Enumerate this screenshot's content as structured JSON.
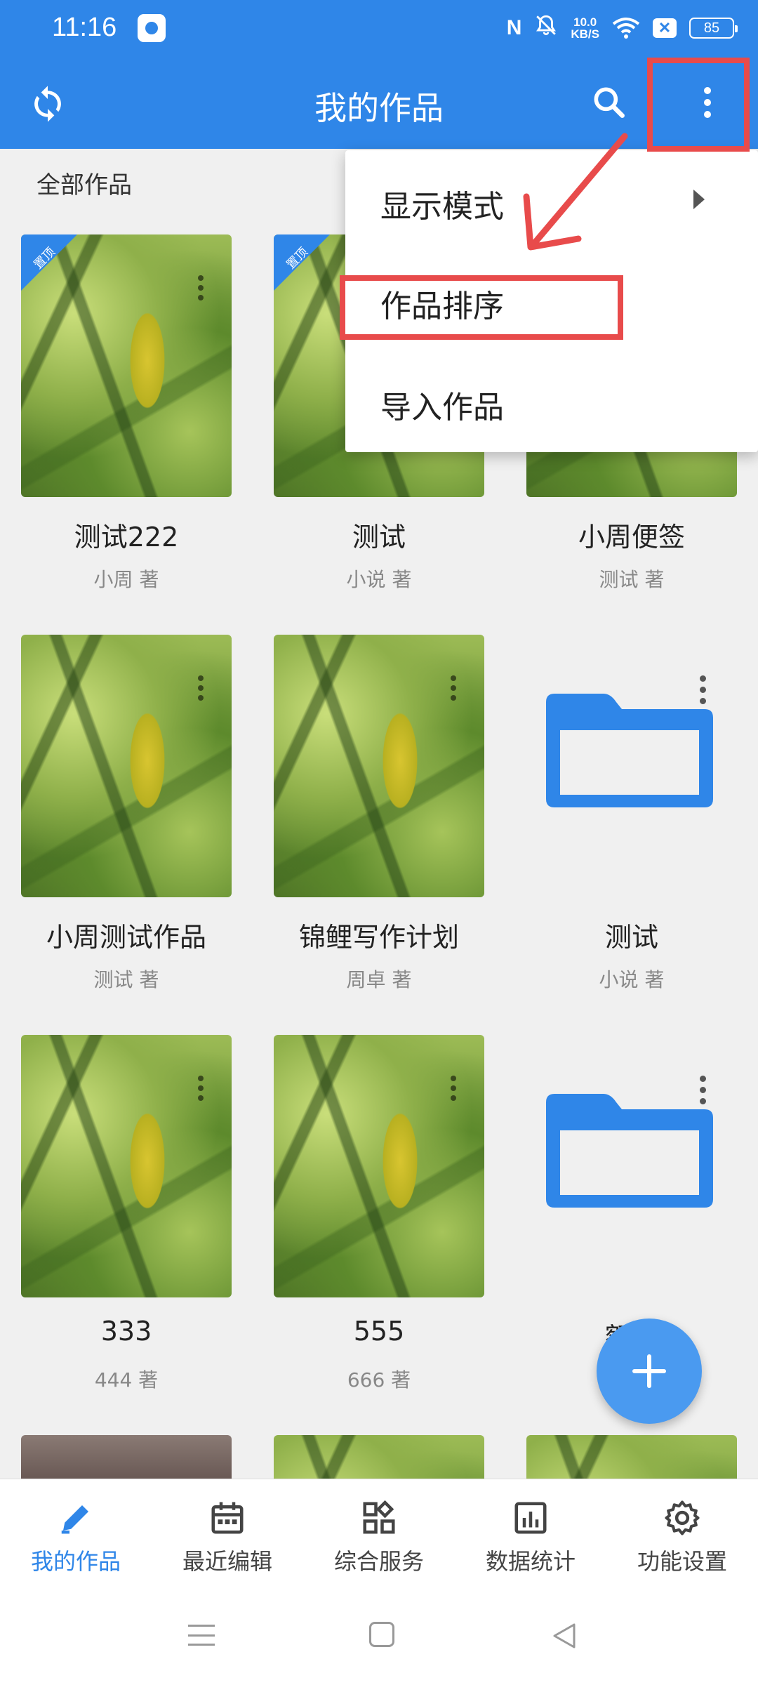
{
  "status_bar": {
    "time": "11:16",
    "nfc": "N",
    "speed_value": "10.0",
    "speed_unit": "KB/S",
    "battery": "85"
  },
  "app_bar": {
    "title": "我的作品"
  },
  "section_label": "全部作品",
  "pin_label": "置顶",
  "works": [
    {
      "title": "测试222",
      "author": "小周 著",
      "type": "cover",
      "pinned": true
    },
    {
      "title": "测试",
      "author": "小说 著",
      "type": "cover",
      "pinned": true
    },
    {
      "title": "小周便签",
      "author": "测试 著",
      "type": "cover",
      "pinned": false
    },
    {
      "title": "小周测试作品",
      "author": "测试 著",
      "type": "cover",
      "pinned": false
    },
    {
      "title": "锦鲤写作计划",
      "author": "周卓 著",
      "type": "cover",
      "pinned": false
    },
    {
      "title": "测试",
      "author": "小说 著",
      "type": "folder",
      "pinned": false
    },
    {
      "title": "333",
      "author": "444 著",
      "type": "cover",
      "pinned": false
    },
    {
      "title": "555",
      "author": "666 著",
      "type": "cover",
      "pinned": false
    },
    {
      "title": "额吉",
      "author": "",
      "type": "folder",
      "pinned": false
    }
  ],
  "menu": {
    "items": [
      "显示模式",
      "作品排序",
      "导入作品"
    ]
  },
  "bottom_nav": [
    {
      "label": "我的作品",
      "icon": "pencil-icon",
      "active": true
    },
    {
      "label": "最近编辑",
      "icon": "calendar-icon",
      "active": false
    },
    {
      "label": "综合服务",
      "icon": "grid-icon",
      "active": false
    },
    {
      "label": "数据统计",
      "icon": "bar-chart-icon",
      "active": false
    },
    {
      "label": "功能设置",
      "icon": "gear-icon",
      "active": false
    }
  ],
  "colors": {
    "primary": "#2f86e8",
    "fab": "#4a9af0",
    "annotation": "#e84b4b"
  }
}
